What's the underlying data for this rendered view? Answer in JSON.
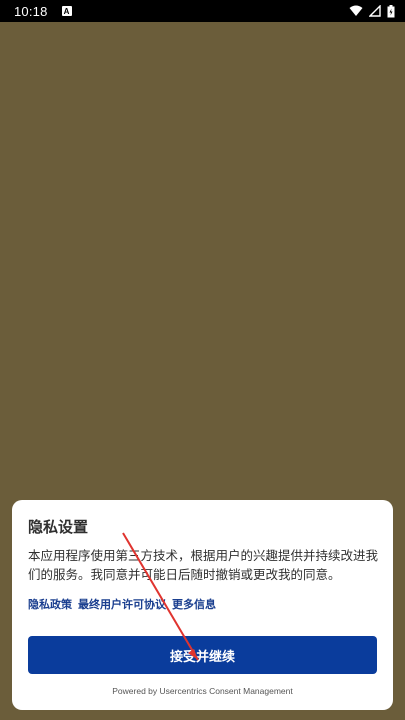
{
  "status_bar": {
    "time": "10:18",
    "notification_icon": "A"
  },
  "dialog": {
    "title": "隐私设置",
    "description": "本应用程序使用第三方技术，根据用户的兴趣提供并持续改进我们的服务。我同意并可能日后随时撤销或更改我的同意。",
    "links": {
      "privacy_policy": "隐私政策",
      "eula": "最终用户许可协议",
      "more_info": "更多信息"
    },
    "accept_button": "接受并继续",
    "powered_by": "Powered by Usercentrics Consent Management"
  },
  "colors": {
    "backdrop": "#6b5d3a",
    "accent": "#0a3c9c",
    "link": "#1a3e8f",
    "annotation_arrow": "#e0342f"
  }
}
